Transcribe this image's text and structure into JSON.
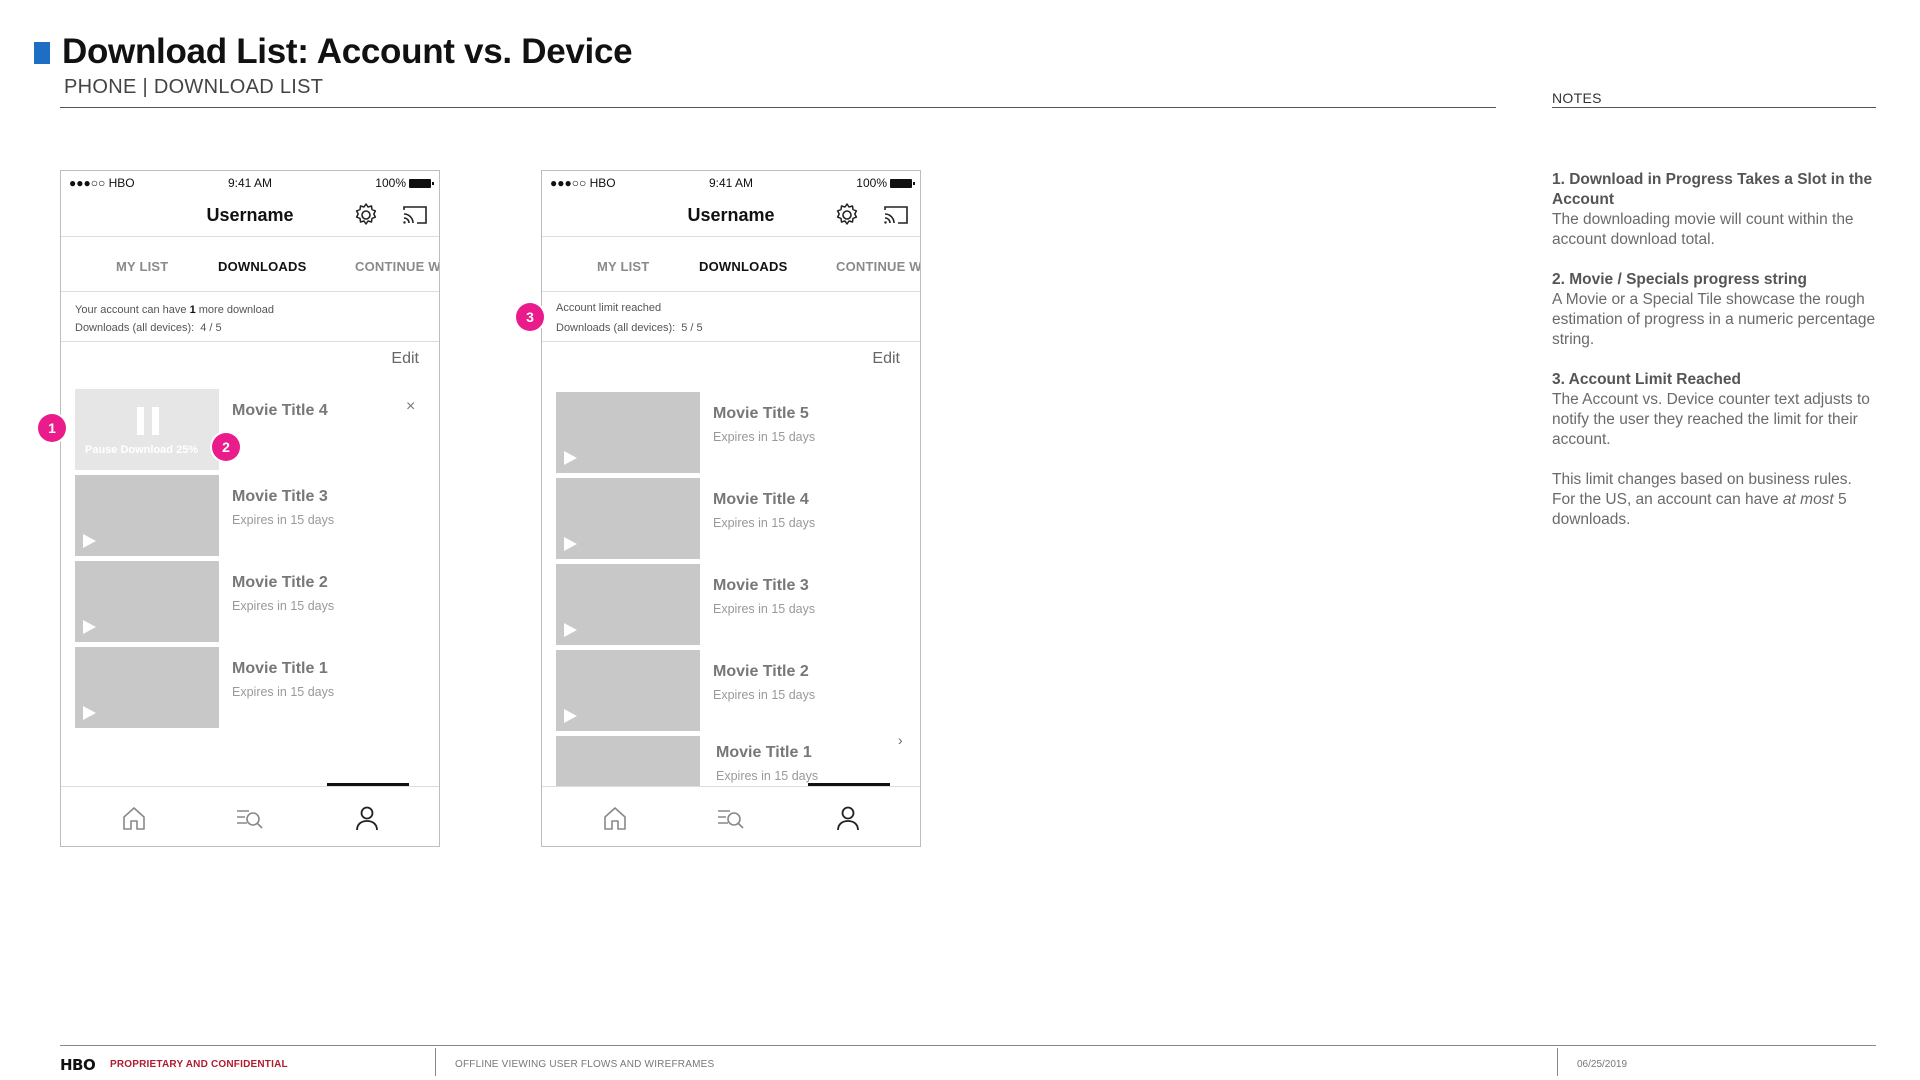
{
  "header": {
    "title": "Download List: Account vs. Device",
    "subtitle": "PHONE | DOWNLOAD LIST",
    "notes_label": "NOTES",
    "accent_color": "#1e6fc4"
  },
  "notes": [
    {
      "heading": "1. Download in Progress Takes a Slot in the Account",
      "body": "The downloading movie will count within the account download total."
    },
    {
      "heading": "2. Movie / Specials progress string",
      "body": "A Movie or a Special Tile showcase the rough estimation of progress in a numeric percentage string."
    },
    {
      "heading": "3. Account Limit Reached",
      "body": "The Account vs. Device counter text adjusts to notify the user they reached the limit for their account."
    },
    {
      "body_pre": "This limit changes based on business rules. For the US, an account can have ",
      "body_em": "at most",
      "body_post": " 5 downloads."
    }
  ],
  "phone_common": {
    "carrier": "●●●○○ HBO",
    "time": "9:41 AM",
    "battery": "100%",
    "username": "Username",
    "tabs": [
      "MY LIST",
      "DOWNLOADS",
      "CONTINUE W"
    ],
    "edit_label": "Edit"
  },
  "phone1": {
    "counter_line1_pre": "Your account can have ",
    "counter_line1_num": "1",
    "counter_line1_post": " more download",
    "counter_line2_label": "Downloads (all devices):",
    "counter_line2_value": "4 / 5",
    "downloading": {
      "title": "Movie Title 4",
      "status": "Pause Download 25%",
      "close": "×"
    },
    "items": [
      {
        "title": "Movie Title 3",
        "subtitle": "Expires in 15 days"
      },
      {
        "title": "Movie Title 2",
        "subtitle": "Expires in 15 days"
      },
      {
        "title": "Movie Title 1",
        "subtitle": "Expires in 15 days"
      }
    ],
    "download_progress_percent": 25
  },
  "phone2": {
    "counter_line1": "Account limit reached",
    "counter_line2_label": "Downloads (all devices):",
    "counter_line2_value": "5 / 5",
    "items": [
      {
        "title": "Movie Title 5",
        "subtitle": "Expires in 15 days"
      },
      {
        "title": "Movie Title 4",
        "subtitle": "Expires in 15 days"
      },
      {
        "title": "Movie Title 3",
        "subtitle": "Expires in 15 days"
      },
      {
        "title": "Movie Title 2",
        "subtitle": "Expires in 15 days"
      },
      {
        "title": "Movie Title 1",
        "subtitle": "Expires in 15 days"
      }
    ]
  },
  "badges": [
    "1",
    "2",
    "3"
  ],
  "badge_color": "#ea1c8c",
  "footer": {
    "logo": "HBO",
    "confidential": "PROPRIETARY AND CONFIDENTIAL",
    "document": "OFFLINE VIEWING USER FLOWS AND WIREFRAMES",
    "date": "06/25/2019",
    "confidential_color": "#b01c2e"
  }
}
